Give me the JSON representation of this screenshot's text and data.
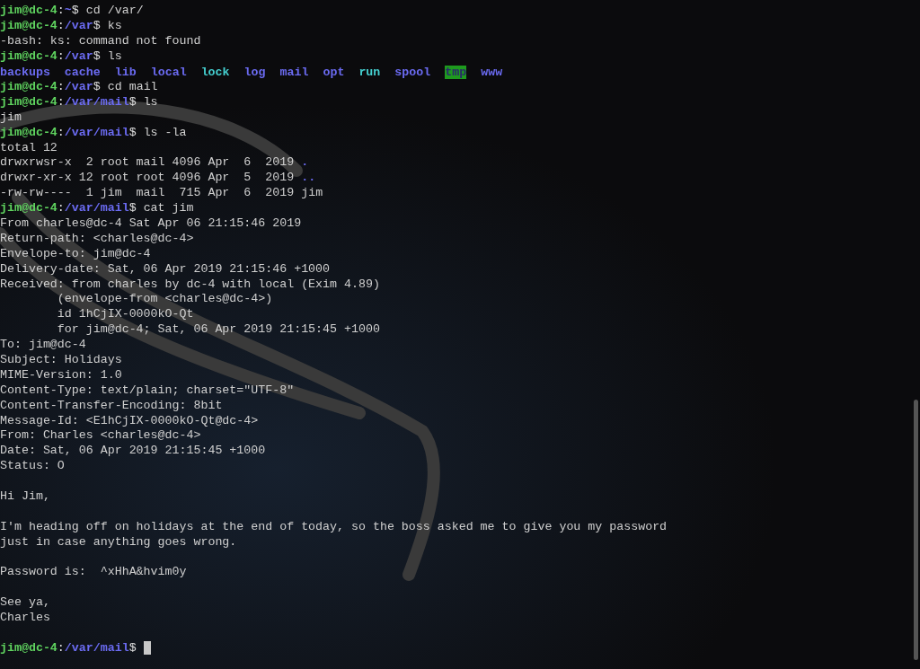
{
  "terminal": {
    "prompt_separator": ":",
    "prompt_sigil": "$",
    "lines": [
      {
        "kind": "prompt",
        "user_host": "jim@dc-4",
        "path": "~",
        "command": "cd /var/",
        "cursor": false
      },
      {
        "kind": "prompt",
        "user_host": "jim@dc-4",
        "path": "/var",
        "command": "ks",
        "cursor": false
      },
      {
        "kind": "output",
        "text": "-bash: ks: command not found"
      },
      {
        "kind": "prompt",
        "user_host": "jim@dc-4",
        "path": "/var",
        "command": "ls",
        "cursor": false
      },
      {
        "kind": "listing",
        "entries": [
          {
            "name": "backups",
            "color": "#6b6bf2",
            "highlighted": false
          },
          {
            "name": "cache",
            "color": "#6b6bf2",
            "highlighted": false
          },
          {
            "name": "lib",
            "color": "#6b6bf2",
            "highlighted": false
          },
          {
            "name": "local",
            "color": "#6b6bf2",
            "highlighted": false
          },
          {
            "name": "lock",
            "color": "#45d0d0",
            "highlighted": false
          },
          {
            "name": "log",
            "color": "#6b6bf2",
            "highlighted": false
          },
          {
            "name": "mail",
            "color": "#6b6bf2",
            "highlighted": false
          },
          {
            "name": "opt",
            "color": "#6b6bf2",
            "highlighted": false
          },
          {
            "name": "run",
            "color": "#45d0d0",
            "highlighted": false
          },
          {
            "name": "spool",
            "color": "#6b6bf2",
            "highlighted": false
          },
          {
            "name": "tmp",
            "color": "#1e9a1e",
            "highlighted": true
          },
          {
            "name": "www",
            "color": "#6b6bf2",
            "highlighted": false
          }
        ]
      },
      {
        "kind": "prompt",
        "user_host": "jim@dc-4",
        "path": "/var",
        "command": "cd mail",
        "cursor": false
      },
      {
        "kind": "prompt",
        "user_host": "jim@dc-4",
        "path": "/var/mail",
        "command": "ls",
        "cursor": false
      },
      {
        "kind": "output",
        "text": "jim"
      },
      {
        "kind": "prompt",
        "user_host": "jim@dc-4",
        "path": "/var/mail",
        "command": "ls -la",
        "cursor": false
      },
      {
        "kind": "output",
        "text": "total 12"
      },
      {
        "kind": "file",
        "meta": "drwxrwsr-x  2 root mail 4096 Apr  6  2019",
        "name": ".",
        "directory": true
      },
      {
        "kind": "file",
        "meta": "drwxr-xr-x 12 root root 4096 Apr  5  2019",
        "name": "..",
        "directory": true
      },
      {
        "kind": "file",
        "meta": "-rw-rw----  1 jim  mail  715 Apr  6  2019",
        "name": "jim",
        "directory": false
      },
      {
        "kind": "prompt",
        "user_host": "jim@dc-4",
        "path": "/var/mail",
        "command": "cat jim",
        "cursor": false
      },
      {
        "kind": "output",
        "text": "From charles@dc-4 Sat Apr 06 21:15:46 2019"
      },
      {
        "kind": "output",
        "text": "Return-path: <charles@dc-4>"
      },
      {
        "kind": "output",
        "text": "Envelope-to: jim@dc-4"
      },
      {
        "kind": "output",
        "text": "Delivery-date: Sat, 06 Apr 2019 21:15:46 +1000"
      },
      {
        "kind": "output",
        "text": "Received: from charles by dc-4 with local (Exim 4.89)"
      },
      {
        "kind": "output",
        "text": "        (envelope-from <charles@dc-4>)"
      },
      {
        "kind": "output",
        "text": "        id 1hCjIX-0000kO-Qt"
      },
      {
        "kind": "output",
        "text": "        for jim@dc-4; Sat, 06 Apr 2019 21:15:45 +1000"
      },
      {
        "kind": "output",
        "text": "To: jim@dc-4"
      },
      {
        "kind": "output",
        "text": "Subject: Holidays"
      },
      {
        "kind": "output",
        "text": "MIME-Version: 1.0"
      },
      {
        "kind": "output",
        "text": "Content-Type: text/plain; charset=\"UTF-8\""
      },
      {
        "kind": "output",
        "text": "Content-Transfer-Encoding: 8bit"
      },
      {
        "kind": "output",
        "text": "Message-Id: <E1hCjIX-0000kO-Qt@dc-4>"
      },
      {
        "kind": "output",
        "text": "From: Charles <charles@dc-4>"
      },
      {
        "kind": "output",
        "text": "Date: Sat, 06 Apr 2019 21:15:45 +1000"
      },
      {
        "kind": "output",
        "text": "Status: O"
      },
      {
        "kind": "blank"
      },
      {
        "kind": "output",
        "text": "Hi Jim,"
      },
      {
        "kind": "blank"
      },
      {
        "kind": "output",
        "text": "I'm heading off on holidays at the end of today, so the boss asked me to give you my password"
      },
      {
        "kind": "output",
        "text": "just in case anything goes wrong."
      },
      {
        "kind": "blank"
      },
      {
        "kind": "output",
        "text": "Password is:  ^xHhA&hvim0y"
      },
      {
        "kind": "blank"
      },
      {
        "kind": "output",
        "text": "See ya,"
      },
      {
        "kind": "output",
        "text": "Charles"
      },
      {
        "kind": "blank"
      },
      {
        "kind": "prompt",
        "user_host": "jim@dc-4",
        "path": "/var/mail",
        "cursor": true
      }
    ]
  }
}
